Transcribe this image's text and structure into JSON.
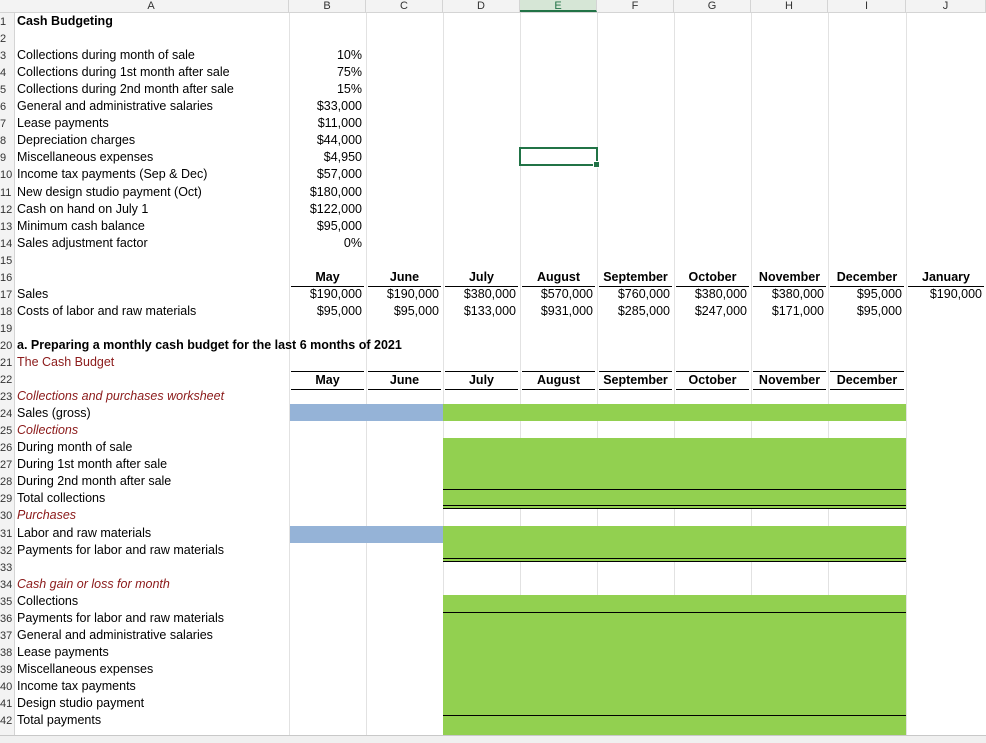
{
  "columns": [
    "A",
    "B",
    "C",
    "D",
    "E",
    "F",
    "G",
    "H",
    "I",
    "J"
  ],
  "selected_column": "E",
  "row_numbers": [
    "1",
    "2",
    "3",
    "4",
    "5",
    "6",
    "7",
    "8",
    "9",
    "10",
    "11",
    "12",
    "13",
    "14",
    "15",
    "16",
    "17",
    "18",
    "19",
    "20",
    "21",
    "22",
    "23",
    "24",
    "25",
    "26",
    "27",
    "28",
    "29",
    "30",
    "31",
    "32",
    "33",
    "34",
    "35",
    "36",
    "37",
    "38",
    "39",
    "40",
    "41",
    "42"
  ],
  "title": "Cash Budgeting",
  "inputs": [
    {
      "label": "Collections during month of sale",
      "value": "10%"
    },
    {
      "label": "Collections during 1st month after sale",
      "value": "75%"
    },
    {
      "label": "Collections during 2nd month after sale",
      "value": "15%"
    },
    {
      "label": "General and administrative salaries",
      "value": "$33,000"
    },
    {
      "label": "Lease payments",
      "value": "$11,000"
    },
    {
      "label": "Depreciation charges",
      "value": "$44,000"
    },
    {
      "label": "Miscellaneous expenses",
      "value": "$4,950"
    },
    {
      "label": "Income tax payments (Sep & Dec)",
      "value": "$57,000"
    },
    {
      "label": "New design studio payment (Oct)",
      "value": "$180,000"
    },
    {
      "label": "Cash on hand on July 1",
      "value": "$122,000"
    },
    {
      "label": "Minimum cash balance",
      "value": "$95,000"
    },
    {
      "label": "Sales adjustment factor",
      "value": "0%"
    }
  ],
  "months": [
    "May",
    "June",
    "July",
    "August",
    "September",
    "October",
    "November",
    "December",
    "January"
  ],
  "sales_row": {
    "label": "Sales",
    "values": [
      "$190,000",
      "$190,000",
      "$380,000",
      "$570,000",
      "$760,000",
      "$380,000",
      "$380,000",
      "$95,000",
      "$190,000"
    ]
  },
  "costs_row": {
    "label": "Costs of labor and raw materials",
    "values": [
      "$95,000",
      "$95,000",
      "$133,000",
      "$931,000",
      "$285,000",
      "$247,000",
      "$171,000",
      "$95,000"
    ]
  },
  "section_a": "a. Preparing a monthly cash budget for the last 6 months of 2021",
  "cash_budget_title": "The Cash Budget",
  "budget_months": [
    "May",
    "June",
    "July",
    "August",
    "September",
    "October",
    "November",
    "December"
  ],
  "worksheet_rows": [
    {
      "label": "Collections and purchases worksheet",
      "style": "italic-red"
    },
    {
      "label": "Sales (gross)",
      "style": "normal"
    },
    {
      "label": "Collections",
      "style": "italic-red"
    },
    {
      "label": "During month of sale",
      "style": "normal"
    },
    {
      "label": "During 1st month after sale",
      "style": "normal"
    },
    {
      "label": "During 2nd month after sale",
      "style": "normal"
    },
    {
      "label": "Total collections",
      "style": "normal"
    },
    {
      "label": "Purchases",
      "style": "italic-red"
    },
    {
      "label": "Labor and raw materials",
      "style": "normal"
    },
    {
      "label": "Payments for labor and raw materials",
      "style": "normal"
    }
  ],
  "gain_loss_rows": [
    {
      "label": "Cash gain or loss for month",
      "style": "italic-red"
    },
    {
      "label": "Collections",
      "style": "normal"
    },
    {
      "label": "Payments for labor and raw materials",
      "style": "normal"
    },
    {
      "label": "General and administrative salaries",
      "style": "normal"
    },
    {
      "label": "Lease payments",
      "style": "normal"
    },
    {
      "label": "Miscellaneous expenses",
      "style": "normal"
    },
    {
      "label": "Income tax payments",
      "style": "normal"
    },
    {
      "label": "Design studio payment",
      "style": "normal"
    },
    {
      "label": "Total payments",
      "style": "normal"
    }
  ],
  "colors": {
    "input_fill": "#92d050",
    "history_fill": "#95b3d7",
    "selection": "#217346",
    "section_text": "#8b1a1a"
  }
}
